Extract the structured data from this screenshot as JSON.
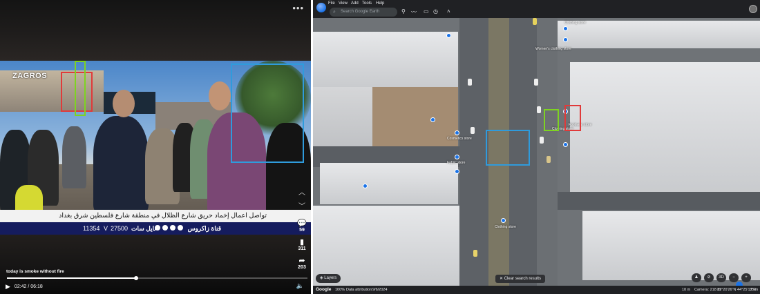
{
  "video": {
    "channel_logo": "ZAGROS",
    "caption": "تواصل اعمال إخماد حريق شارع الظلال في منطقة شارع فلسطين شرق بغداد",
    "ticker": {
      "channel_name": "قناة زاكروس",
      "satellite": "نايل سات",
      "polarization": "V",
      "frequency": "27500",
      "symbol_rate": "11354"
    },
    "side_rail": {
      "likes": "59",
      "saves": "311",
      "shares": "203"
    },
    "title": "today is smoke without fire",
    "time": "02:42 / 06:18",
    "progress": 0.43,
    "icons": {
      "more": "more-icon",
      "play": "play-icon",
      "volume": "volume-icon",
      "comment": "comment-icon",
      "bookmark": "bookmark-icon",
      "share": "share-icon"
    }
  },
  "earth": {
    "menu": [
      "File",
      "View",
      "Add",
      "Tools",
      "Help"
    ],
    "search_placeholder": "Search Google Earth",
    "layers_label": "Layers",
    "clear_label": "Clear search results",
    "nav_buttons": [
      "3D"
    ],
    "status": {
      "brand": "Google",
      "zoom": "100%",
      "attribution": "Data attribution",
      "date": "9/6/2024",
      "scale": "10 m",
      "camera": "Camera: 218 m",
      "coords": "33°20'26\"N 44°25'17\"E",
      "elev": "33 m"
    },
    "place_labels": [
      "Clothing store",
      "Cosmetics store",
      "Fabric store",
      "Clothing store",
      "Footwear store",
      "Women's clothing store",
      "Clothing store"
    ],
    "colors": {
      "box_red": "#e03a3a",
      "box_green": "#7ed321",
      "box_blue": "#2f9bdc"
    }
  }
}
